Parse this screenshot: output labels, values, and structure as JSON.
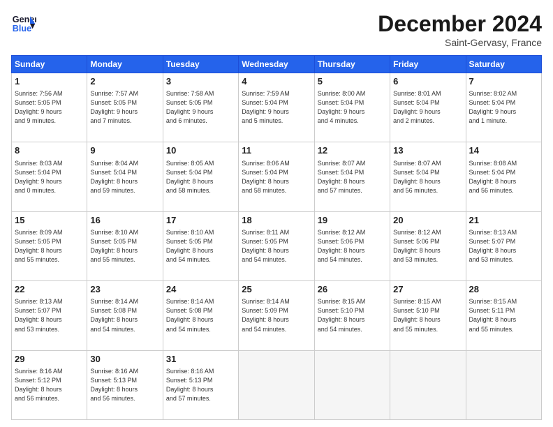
{
  "header": {
    "logo_line1": "General",
    "logo_line2": "Blue",
    "month": "December 2024",
    "location": "Saint-Gervasy, France"
  },
  "weekdays": [
    "Sunday",
    "Monday",
    "Tuesday",
    "Wednesday",
    "Thursday",
    "Friday",
    "Saturday"
  ],
  "weeks": [
    [
      {
        "day": "1",
        "info": "Sunrise: 7:56 AM\nSunset: 5:05 PM\nDaylight: 9 hours\nand 9 minutes."
      },
      {
        "day": "2",
        "info": "Sunrise: 7:57 AM\nSunset: 5:05 PM\nDaylight: 9 hours\nand 7 minutes."
      },
      {
        "day": "3",
        "info": "Sunrise: 7:58 AM\nSunset: 5:05 PM\nDaylight: 9 hours\nand 6 minutes."
      },
      {
        "day": "4",
        "info": "Sunrise: 7:59 AM\nSunset: 5:04 PM\nDaylight: 9 hours\nand 5 minutes."
      },
      {
        "day": "5",
        "info": "Sunrise: 8:00 AM\nSunset: 5:04 PM\nDaylight: 9 hours\nand 4 minutes."
      },
      {
        "day": "6",
        "info": "Sunrise: 8:01 AM\nSunset: 5:04 PM\nDaylight: 9 hours\nand 2 minutes."
      },
      {
        "day": "7",
        "info": "Sunrise: 8:02 AM\nSunset: 5:04 PM\nDaylight: 9 hours\nand 1 minute."
      }
    ],
    [
      {
        "day": "8",
        "info": "Sunrise: 8:03 AM\nSunset: 5:04 PM\nDaylight: 9 hours\nand 0 minutes."
      },
      {
        "day": "9",
        "info": "Sunrise: 8:04 AM\nSunset: 5:04 PM\nDaylight: 8 hours\nand 59 minutes."
      },
      {
        "day": "10",
        "info": "Sunrise: 8:05 AM\nSunset: 5:04 PM\nDaylight: 8 hours\nand 58 minutes."
      },
      {
        "day": "11",
        "info": "Sunrise: 8:06 AM\nSunset: 5:04 PM\nDaylight: 8 hours\nand 58 minutes."
      },
      {
        "day": "12",
        "info": "Sunrise: 8:07 AM\nSunset: 5:04 PM\nDaylight: 8 hours\nand 57 minutes."
      },
      {
        "day": "13",
        "info": "Sunrise: 8:07 AM\nSunset: 5:04 PM\nDaylight: 8 hours\nand 56 minutes."
      },
      {
        "day": "14",
        "info": "Sunrise: 8:08 AM\nSunset: 5:04 PM\nDaylight: 8 hours\nand 56 minutes."
      }
    ],
    [
      {
        "day": "15",
        "info": "Sunrise: 8:09 AM\nSunset: 5:05 PM\nDaylight: 8 hours\nand 55 minutes."
      },
      {
        "day": "16",
        "info": "Sunrise: 8:10 AM\nSunset: 5:05 PM\nDaylight: 8 hours\nand 55 minutes."
      },
      {
        "day": "17",
        "info": "Sunrise: 8:10 AM\nSunset: 5:05 PM\nDaylight: 8 hours\nand 54 minutes."
      },
      {
        "day": "18",
        "info": "Sunrise: 8:11 AM\nSunset: 5:05 PM\nDaylight: 8 hours\nand 54 minutes."
      },
      {
        "day": "19",
        "info": "Sunrise: 8:12 AM\nSunset: 5:06 PM\nDaylight: 8 hours\nand 54 minutes."
      },
      {
        "day": "20",
        "info": "Sunrise: 8:12 AM\nSunset: 5:06 PM\nDaylight: 8 hours\nand 53 minutes."
      },
      {
        "day": "21",
        "info": "Sunrise: 8:13 AM\nSunset: 5:07 PM\nDaylight: 8 hours\nand 53 minutes."
      }
    ],
    [
      {
        "day": "22",
        "info": "Sunrise: 8:13 AM\nSunset: 5:07 PM\nDaylight: 8 hours\nand 53 minutes."
      },
      {
        "day": "23",
        "info": "Sunrise: 8:14 AM\nSunset: 5:08 PM\nDaylight: 8 hours\nand 54 minutes."
      },
      {
        "day": "24",
        "info": "Sunrise: 8:14 AM\nSunset: 5:08 PM\nDaylight: 8 hours\nand 54 minutes."
      },
      {
        "day": "25",
        "info": "Sunrise: 8:14 AM\nSunset: 5:09 PM\nDaylight: 8 hours\nand 54 minutes."
      },
      {
        "day": "26",
        "info": "Sunrise: 8:15 AM\nSunset: 5:10 PM\nDaylight: 8 hours\nand 54 minutes."
      },
      {
        "day": "27",
        "info": "Sunrise: 8:15 AM\nSunset: 5:10 PM\nDaylight: 8 hours\nand 55 minutes."
      },
      {
        "day": "28",
        "info": "Sunrise: 8:15 AM\nSunset: 5:11 PM\nDaylight: 8 hours\nand 55 minutes."
      }
    ],
    [
      {
        "day": "29",
        "info": "Sunrise: 8:16 AM\nSunset: 5:12 PM\nDaylight: 8 hours\nand 56 minutes."
      },
      {
        "day": "30",
        "info": "Sunrise: 8:16 AM\nSunset: 5:13 PM\nDaylight: 8 hours\nand 56 minutes."
      },
      {
        "day": "31",
        "info": "Sunrise: 8:16 AM\nSunset: 5:13 PM\nDaylight: 8 hours\nand 57 minutes."
      },
      {
        "day": "",
        "info": ""
      },
      {
        "day": "",
        "info": ""
      },
      {
        "day": "",
        "info": ""
      },
      {
        "day": "",
        "info": ""
      }
    ]
  ]
}
